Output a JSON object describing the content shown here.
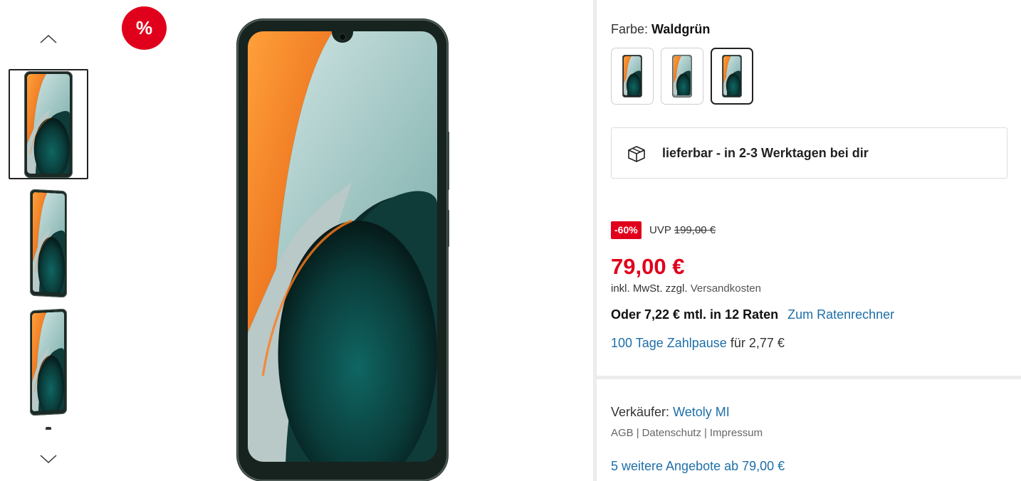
{
  "gallery": {
    "sale_badge": "%",
    "up_arrow_icon": "chevron-up-icon",
    "down_arrow_icon": "chevron-down-icon",
    "thumbnails": [
      {
        "view": "front",
        "selected": true
      },
      {
        "view": "angled",
        "selected": false
      },
      {
        "view": "angled",
        "selected": false
      }
    ]
  },
  "product": {
    "color_label": "Farbe:",
    "color_value": "Waldgrün",
    "color_swatches": [
      {
        "selected": false
      },
      {
        "selected": false
      },
      {
        "selected": true
      }
    ],
    "delivery_icon": "package-icon",
    "delivery_text": "lieferbar - in 2-3 Werktagen bei dir",
    "discount_badge": "-60%",
    "uvp_label": "UVP",
    "uvp_price": "199,00 €",
    "price": "79,00 €",
    "tax_note": "inkl. MwSt. zzgl.",
    "shipping_link": "Versandkosten",
    "installment_text": "Oder 7,22 € mtl. in 12 Raten",
    "installment_link": "Zum Ratenrechner",
    "pause_link": "100 Tage Zahlpause",
    "pause_text": "für 2,77 €"
  },
  "seller": {
    "label": "Verkäufer:",
    "name": "Wetoly MI",
    "agb": "AGB",
    "privacy": "Datenschutz",
    "imprint": "Impressum",
    "separator": "|",
    "more_offers": "5 weitere Angebote ab 79,00 €"
  },
  "colors": {
    "accent_red": "#e0001b",
    "link_blue": "#1e6fa8"
  }
}
